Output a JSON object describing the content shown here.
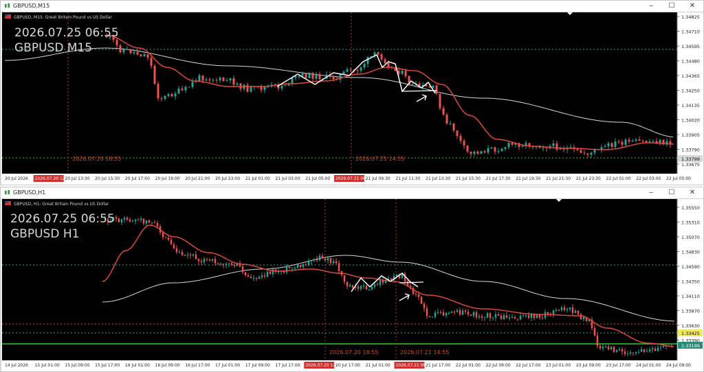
{
  "windows": [
    {
      "title": "GBPUSD,M15",
      "symbol_desc": "GBPUSD, M15: Great Britain Pound vs US Dollar",
      "watermark_time": "2026.07.25 06:55",
      "watermark_symbol": "GBPUSD M15",
      "price_labels": [
        "1.34825",
        "1.34710",
        "1.34595",
        "1.34480",
        "1.34365",
        "1.34250",
        "1.34135",
        "1.34020",
        "1.33905",
        "1.33790",
        "1.33675"
      ],
      "current_price_label": "1.33799",
      "time_labels": [
        "20 Jul 2026",
        "2026.07.20 12:00",
        "20 Jul 13:30",
        "20 Jul 15:30",
        "20 Jul 17:00",
        "20 Jul 19:00",
        "20 Jul 21:00",
        "20 Jul 23:00",
        "21 Jul 01:00",
        "21 Jul 03:00",
        "21 Jul 05:00",
        "2026.07.21 08:00",
        "21 Jul 09:30",
        "21 Jul 11:30",
        "21 Jul 13:30",
        "21 Jul 15:30",
        "21 Jul 17:30",
        "21 Jul 19:30",
        "21 Jul 21:30",
        "21 Jul 23:30",
        "22 Jul 01:00",
        "22 Jul 03:00",
        "22 Jul 05:00"
      ],
      "vline_label_1": "2026.07.20 18:55",
      "vline_label_2": "2026.07.21 14:55"
    },
    {
      "title": "GBPUSD,H1",
      "symbol_desc": "GBPUSD, H1: Great Britain Pound vs US Dollar",
      "watermark_time": "2026.07.25 06:55",
      "watermark_symbol": "GBPUSD H1",
      "price_labels": [
        "1.35550",
        "1.35310",
        "1.35070",
        "1.34830",
        "1.34590",
        "1.34350",
        "1.34110",
        "1.33870",
        "1.33630",
        "1.33390"
      ],
      "current_price_label": "1.33425",
      "green_price_label": "1.33199",
      "time_labels": [
        "14 Jul 2026",
        "15 Jul 01:00",
        "15 Jul 09:00",
        "15 Jul 17:00",
        "16 Jul 01:00",
        "16 Jul 09:00",
        "16 Jul 17:00",
        "17 Jul 01:00",
        "17 Jul 09:00",
        "17 Jul 17:00",
        "2026.07.20 12:00",
        "20 Jul 17:00",
        "21 Jul 01:00",
        "2026.07.21 08:00",
        "21 Jul 17:00",
        "22 Jul 01:00",
        "22 Jul 09:00",
        "22 Jul 17:00",
        "23 Jul 01:00",
        "23 Jul 09:00",
        "23 Jul 17:00",
        "24 Jul 01:00",
        "24 Jul 09:00"
      ],
      "vline_label_1": "2026.07.20 18:55",
      "vline_label_2": "2026.07.21 14:55"
    }
  ],
  "colors": {
    "bg": "#000000",
    "bull": "#26a69a",
    "bear": "#ef5350",
    "ma_fast": "#e0483c",
    "ma_slow": "#d8d8d8",
    "zigzag": "#ffffff",
    "vline": "#c0392b",
    "hline_teal": "#3aa8a0",
    "hline_orange": "#d06030",
    "hline_green": "#33cc33",
    "axis_text": "#c8c8c8"
  },
  "icons": [
    "chart-window-icon",
    "minimize-icon",
    "maximize-icon",
    "close-icon",
    "flag-icon"
  ]
}
